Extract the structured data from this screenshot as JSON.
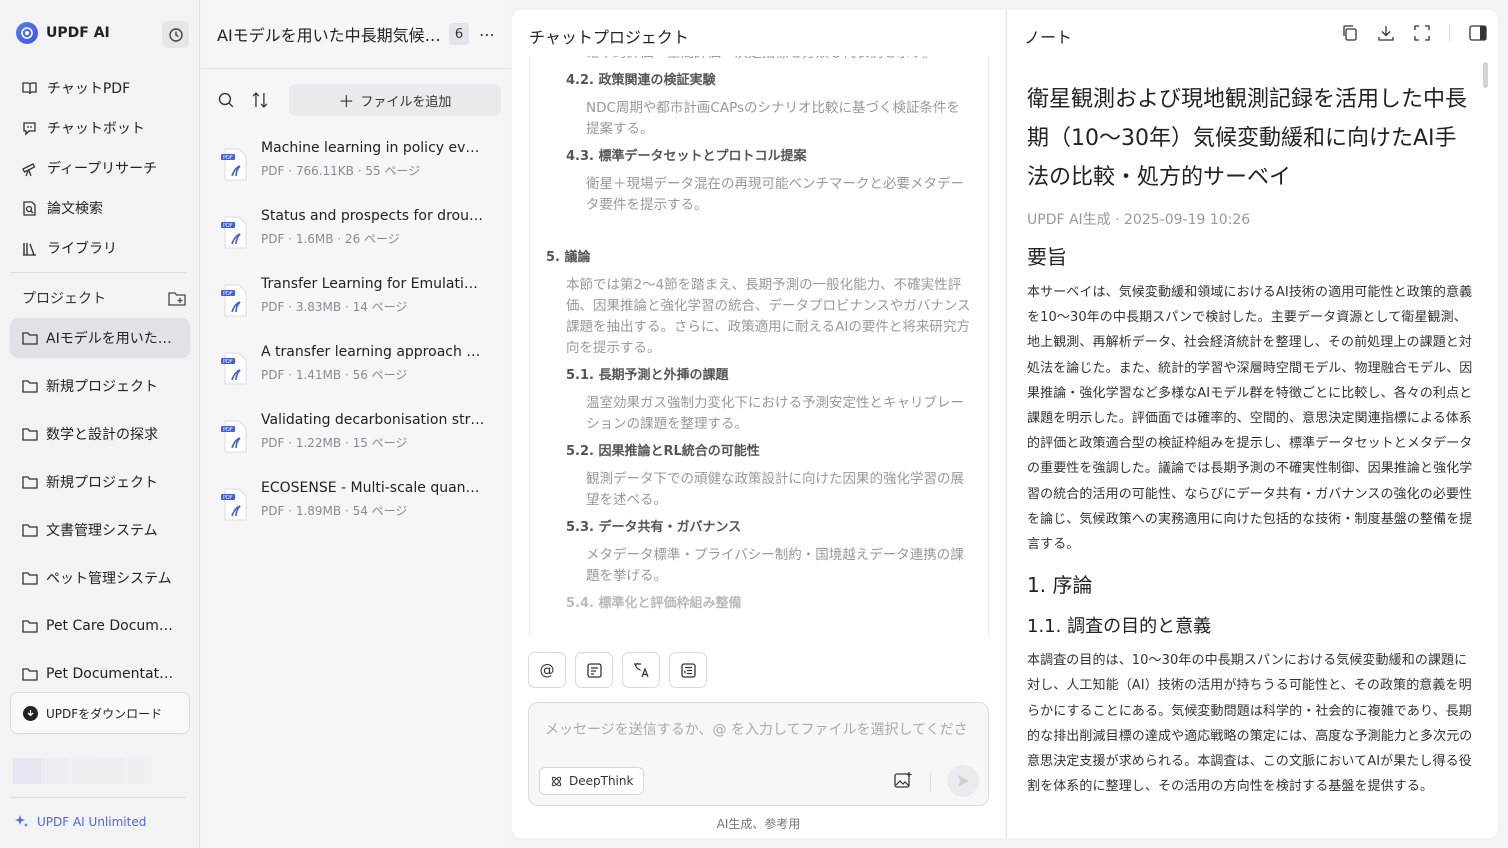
{
  "sidebar": {
    "brand": "UPDF AI",
    "nav": [
      {
        "label": "チャットPDF",
        "icon": "book-icon"
      },
      {
        "label": "チャットボット",
        "icon": "chat-bot-icon"
      },
      {
        "label": "ディープリサーチ",
        "icon": "telescope-icon"
      },
      {
        "label": "論文検索",
        "icon": "doc-search-icon"
      },
      {
        "label": "ライブラリ",
        "icon": "library-icon"
      }
    ],
    "projects_label": "プロジェクト",
    "projects": [
      "AIモデルを用いた…",
      "新規プロジェクト",
      "数学と設計の探求",
      "新規プロジェクト",
      "文書管理システム",
      "ペット管理システム",
      "Pet Care Docume…",
      "Pet Documentati…"
    ],
    "download_label": "UPDFをダウンロード",
    "unlimited_label": "UPDF AI Unlimited"
  },
  "filecol": {
    "title": "AIモデルを用いた中長期気候…",
    "count": "6",
    "more": "⋯",
    "add_file": "ファイルを追加",
    "files": [
      {
        "title": "Machine learning in policy eval...",
        "meta": "PDF · 766.11KB · 55 ページ"
      },
      {
        "title": "Status and prospects for droug...",
        "meta": "PDF · 1.6MB · 26 ページ"
      },
      {
        "title": "Transfer Learning for Emulating...",
        "meta": "PDF · 3.83MB · 14 ページ"
      },
      {
        "title": "A transfer learning approach fo...",
        "meta": "PDF · 1.41MB · 56 ページ"
      },
      {
        "title": "Validating decarbonisation stra...",
        "meta": "PDF · 1.22MB · 15 ページ"
      },
      {
        "title": "ECOSENSE - Multi-scale quantif...",
        "meta": "PDF · 1.89MB · 54 ページ"
      }
    ]
  },
  "chat": {
    "title": "チャットプロジェクト",
    "outline": {
      "top_desc": "確率的評価・空間評価・決定指標を分類し代表例を示す。",
      "s42": "4.2. 政策関連の検証実験",
      "s42_desc": "NDC周期や都市計画CAPsのシナリオ比較に基づく検証条件を提案する。",
      "s43": "4.3. 標準データセットとプロトコル提案",
      "s43_desc": "衛星＋現場データ混在の再現可能ベンチマークと必要メタデータ要件を提示する。",
      "s5": "5. 議論",
      "s5_desc": "本節では第2～4節を踏まえ、長期予測の一般化能力、不確実性評価、因果推論と強化学習の統合、データプロビナンスやガバナンス課題を抽出する。さらに、政策適用に耐えるAIの要件と将来研究方向を提示する。",
      "s51": "5.1. 長期予測と外挿の課題",
      "s51_desc": "温室効果ガス強制力変化下における予測安定性とキャリブレーションの課題を整理する。",
      "s52": "5.2. 因果推論とRL統合の可能性",
      "s52_desc": "観測データ下での頑健な政策設計に向けた因果的強化学習の展望を述べる。",
      "s53": "5.3. データ共有・ガバナンス",
      "s53_desc": "メタデータ標準・プライバシー制約・国境越えデータ連携の課題を挙げる。",
      "s54": "5.4. 標準化と評価枠組み整備"
    },
    "tools": [
      "@",
      "summary-icon",
      "translate-icon",
      "outline-icon"
    ],
    "placeholder": "メッセージを送信するか、@ を入力してファイルを選択してくださ",
    "deepthink": "DeepThink",
    "footer": "AI生成、参考用"
  },
  "note": {
    "header": "ノート",
    "title": "衛星観測および現地観測記録を活用した中長期（10～30年）気候変動緩和に向けたAI手法の比較・処方的サーベイ",
    "meta": "UPDF AI生成 · 2025-09-19 10:26",
    "h_summary": "要旨",
    "summary": "本サーベイは、気候変動緩和領域におけるAI技術の適用可能性と政策的意義を10～30年の中長期スパンで検討した。主要データ資源として衛星観測、地上観測、再解析データ、社会経済統計を整理し、その前処理上の課題と対処法を論じた。また、統計的学習や深層時空間モデル、物理融合モデル、因果推論・強化学習など多様なAIモデル群を特徴ごとに比較し、各々の利点と課題を明示した。評価面では確率的、空間的、意思決定関連指標による体系的評価と政策適合型の検証枠組みを提示し、標準データセットとメタデータの重要性を強調した。議論では長期予測の不確実性制御、因果推論と強化学習の統合的活用の可能性、ならびにデータ共有・ガバナンスの強化の必要性を論じ、気候政策への実務適用に向けた包括的な技術・制度基盤の整備を提言する。",
    "h1": "1. 序論",
    "h11": "1.1. 調査の目的と意義",
    "p11": "本調査の目的は、10～30年の中長期スパンにおける気候変動緩和の課題に対し、人工知能（AI）技術の活用が持ちうる可能性と、その政策的意義を明らかにすることにある。気候変動問題は科学的・社会的に複雑であり、長期的な排出削減目標の達成や適応戦略の策定には、高度な予測能力と多次元の意思決定支援が求められる。本調査は、この文脈においてAIが果たし得る役割を体系的に整理し、その活用の方向性を検討する基盤を提供する。"
  },
  "colors": {
    "accent": "#4868e8",
    "sidebar_bg": "#f3f3f5",
    "active_item_bg": "#e1e1e7",
    "muted_text": "#999999"
  }
}
